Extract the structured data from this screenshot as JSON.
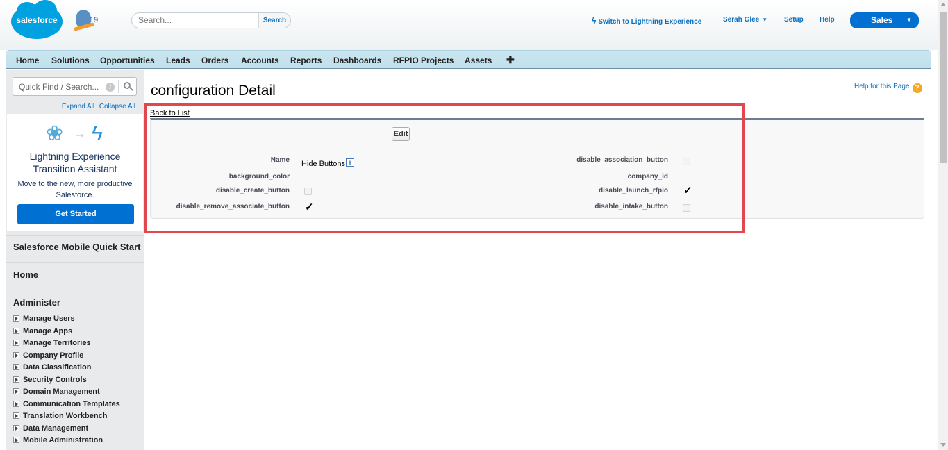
{
  "header": {
    "logo_text": "salesforce",
    "mascot_text": "19",
    "search_placeholder": "Search...",
    "search_button": "Search",
    "lightning_switch": "Switch to Lightning Experience",
    "user_name": "Serah Glee",
    "setup": "Setup",
    "help": "Help",
    "app_menu": "Sales"
  },
  "tabs": [
    "Home",
    "Solutions",
    "Opportunities",
    "Leads",
    "Orders",
    "Accounts",
    "Reports",
    "Dashboards",
    "RFPIO Projects",
    "Assets"
  ],
  "tab_plus": "✚",
  "sidebar": {
    "quickfind_placeholder": "Quick Find / Search...",
    "expand_all": "Expand All",
    "separator": "|",
    "collapse_all": "Collapse All",
    "lex_title_line1": "Lightning Experience",
    "lex_title_line2": "Transition Assistant",
    "lex_sub": "Move to the new, more productive Salesforce.",
    "get_started": "Get Started",
    "mobile_quick_start": "Salesforce Mobile Quick Start",
    "home": "Home",
    "administer": "Administer",
    "admin_items": [
      "Manage Users",
      "Manage Apps",
      "Manage Territories",
      "Company Profile",
      "Data Classification",
      "Security Controls",
      "Domain Management",
      "Communication Templates",
      "Translation Workbench",
      "Data Management",
      "Mobile Administration"
    ]
  },
  "main": {
    "title": "configuration Detail",
    "help_for_page": "Help for this Page",
    "help_icon": "?",
    "back_to_list": "Back to List",
    "edit_button": "Edit",
    "info_badge": "i",
    "fields": {
      "name_label": "Name",
      "name_value": "Hide Buttons",
      "background_color_label": "background_color",
      "disable_create_button_label": "disable_create_button",
      "disable_remove_associate_button_label": "disable_remove_associate_button",
      "disable_association_button_label": "disable_association_button",
      "company_id_label": "company_id",
      "disable_launch_rfpio_label": "disable_launch_rfpio",
      "disable_intake_button_label": "disable_intake_button"
    },
    "checkboxes": {
      "disable_create_button": false,
      "disable_remove_associate_button": true,
      "disable_association_button": false,
      "disable_launch_rfpio": true,
      "disable_intake_button": false
    },
    "check_glyph": "✓"
  },
  "colors": {
    "brand_blue": "#00a1e0",
    "button_blue": "#0070d2",
    "link_blue": "#0b6fbd",
    "highlight_red": "#e0474f",
    "tab_bg": "#cbe6f0"
  }
}
